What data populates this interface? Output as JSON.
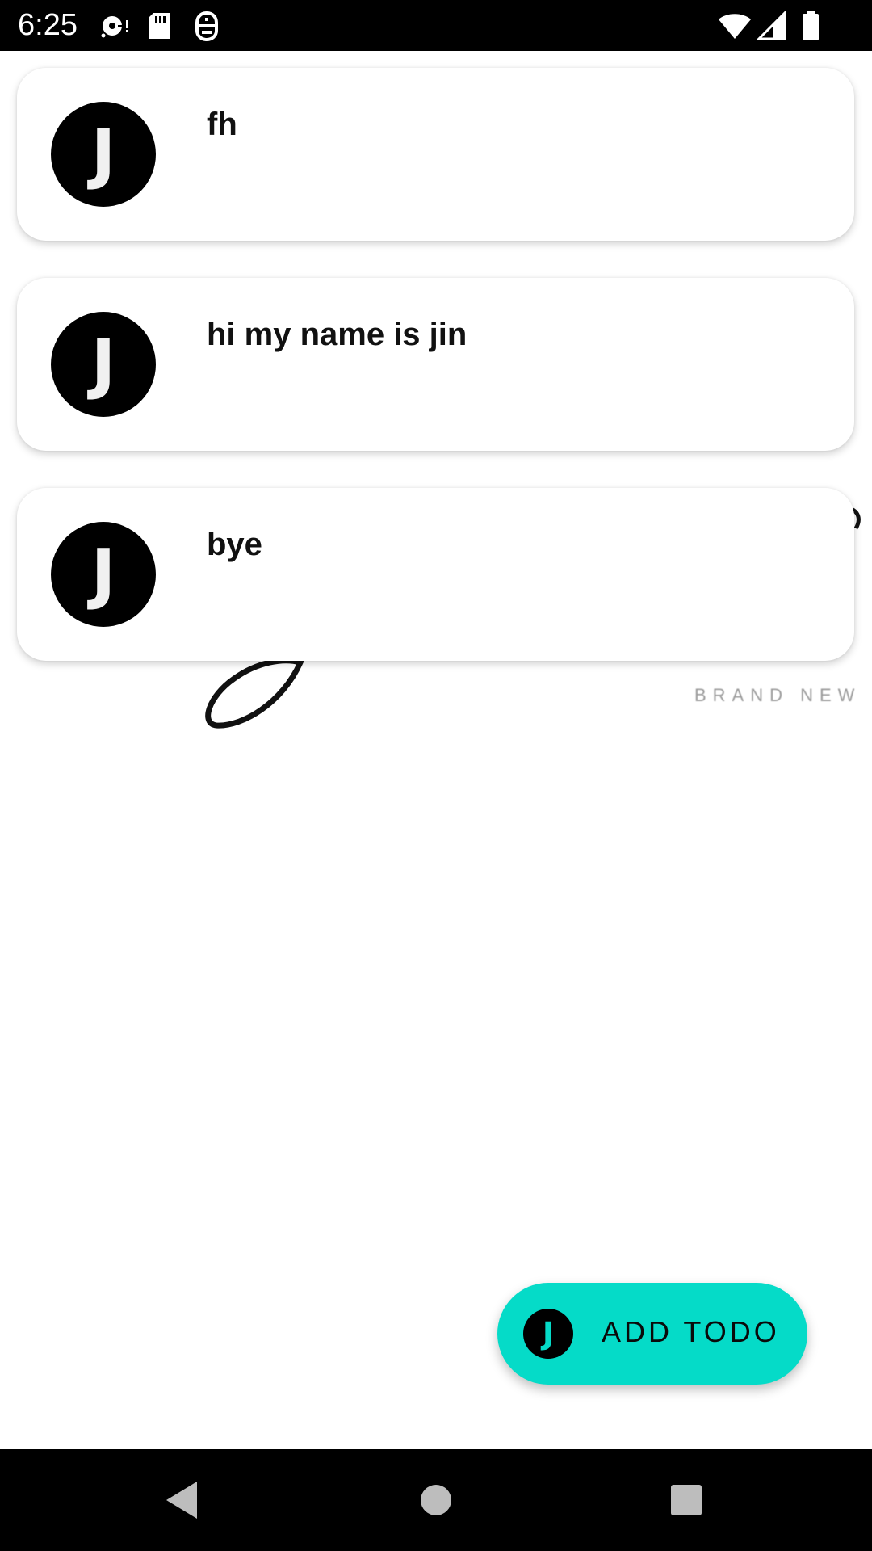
{
  "status_bar": {
    "time": "6:25",
    "left_icons": [
      "media-icon",
      "sd-card-icon",
      "debug-icon"
    ],
    "right_icons": [
      "wifi-icon",
      "signal-icon",
      "battery-icon"
    ]
  },
  "background": {
    "brand_text": "BRAND NEW"
  },
  "todos": [
    {
      "avatar_letter": "J",
      "title": "fh"
    },
    {
      "avatar_letter": "J",
      "title": "hi my name is jin"
    },
    {
      "avatar_letter": "J",
      "title": "bye"
    }
  ],
  "fab": {
    "avatar_letter": "J",
    "label": "ADD TODO",
    "color": "#05dbc8"
  },
  "nav_bar": {
    "buttons": [
      "back-icon",
      "home-icon",
      "recents-icon"
    ]
  }
}
